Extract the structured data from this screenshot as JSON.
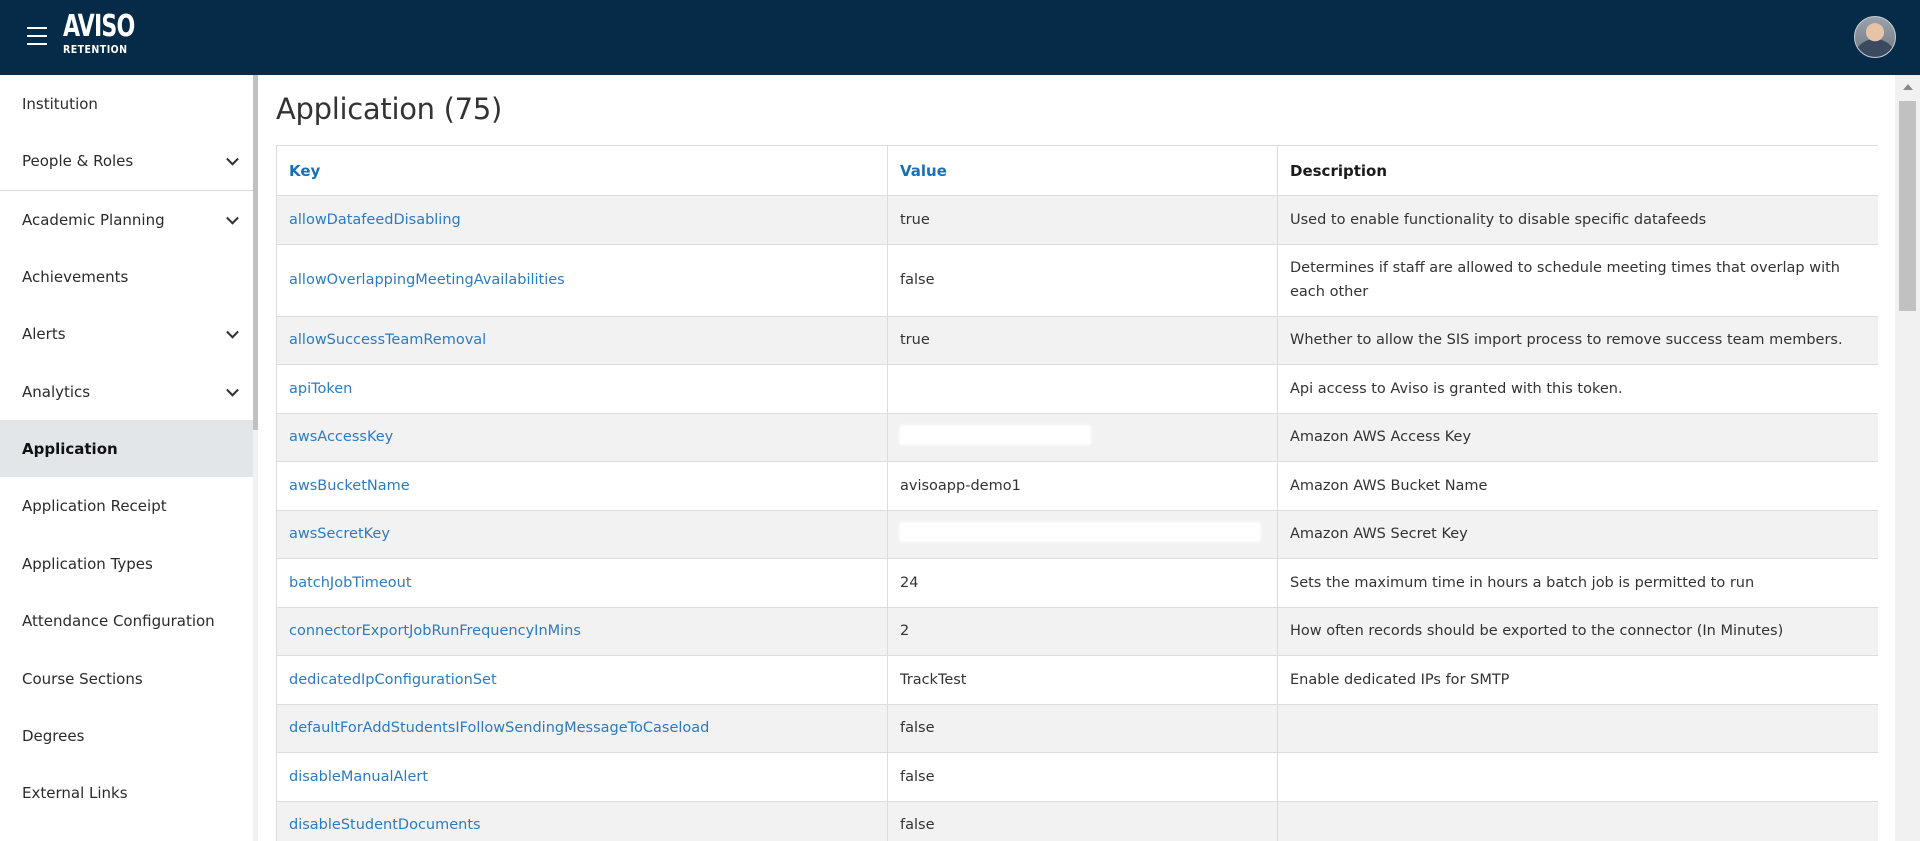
{
  "app": {
    "logo_main": "AVISO",
    "logo_sub": "RETENTION"
  },
  "sidebar": {
    "items": [
      {
        "label": "Institution",
        "expandable": false
      },
      {
        "label": "People & Roles",
        "expandable": true
      },
      {
        "label": "Academic Planning",
        "expandable": true
      },
      {
        "label": "Achievements",
        "expandable": false
      },
      {
        "label": "Alerts",
        "expandable": true
      },
      {
        "label": "Analytics",
        "expandable": true
      },
      {
        "label": "Application",
        "expandable": false,
        "active": true
      },
      {
        "label": "Application Receipt",
        "expandable": false
      },
      {
        "label": "Application Types",
        "expandable": false
      },
      {
        "label": "Attendance Configuration",
        "expandable": false
      },
      {
        "label": "Course Sections",
        "expandable": false
      },
      {
        "label": "Degrees",
        "expandable": false
      },
      {
        "label": "External Links",
        "expandable": false
      }
    ]
  },
  "main": {
    "title": "Application (75)",
    "table": {
      "headers": {
        "key": "Key",
        "value": "Value",
        "description": "Description"
      },
      "rows": [
        {
          "key": "allowDatafeedDisabling",
          "value": "true",
          "description": "Used to enable functionality to disable specific datafeeds"
        },
        {
          "key": "allowOverlappingMeetingAvailabilities",
          "value": "false",
          "description": "Determines if staff are allowed to schedule meeting times that overlap with each other"
        },
        {
          "key": "allowSuccessTeamRemoval",
          "value": "true",
          "description": "Whether to allow the SIS import process to remove success team members."
        },
        {
          "key": "apiToken",
          "value": "",
          "description": "Api access to Aviso is granted with this token."
        },
        {
          "key": "awsAccessKey",
          "value": "",
          "description": "Amazon AWS Access Key"
        },
        {
          "key": "awsBucketName",
          "value": "avisoapp-demo1",
          "description": "Amazon AWS Bucket Name"
        },
        {
          "key": "awsSecretKey",
          "value": "",
          "description": "Amazon AWS Secret Key"
        },
        {
          "key": "batchJobTimeout",
          "value": "24",
          "description": "Sets the maximum time in hours a batch job is permitted to run"
        },
        {
          "key": "connectorExportJobRunFrequencyInMins",
          "value": "2",
          "description": "How often records should be exported to the connector (In Minutes)"
        },
        {
          "key": "dedicatedIpConfigurationSet",
          "value": "TrackTest",
          "description": "Enable dedicated IPs for SMTP"
        },
        {
          "key": "defaultForAddStudentsIFollowSendingMessageToCaseload",
          "value": "false",
          "description": ""
        },
        {
          "key": "disableManualAlert",
          "value": "false",
          "description": ""
        },
        {
          "key": "disableStudentDocuments",
          "value": "false",
          "description": ""
        }
      ]
    }
  },
  "colors": {
    "topbar": "#062b48",
    "link": "#2c7bc2",
    "active_nav": "#e3e6e9",
    "stripe": "#f2f2f2"
  },
  "icons": [
    "hamburger-menu-icon",
    "user-avatar",
    "chevron-down-icon",
    "scroll-up-arrow-icon"
  ]
}
